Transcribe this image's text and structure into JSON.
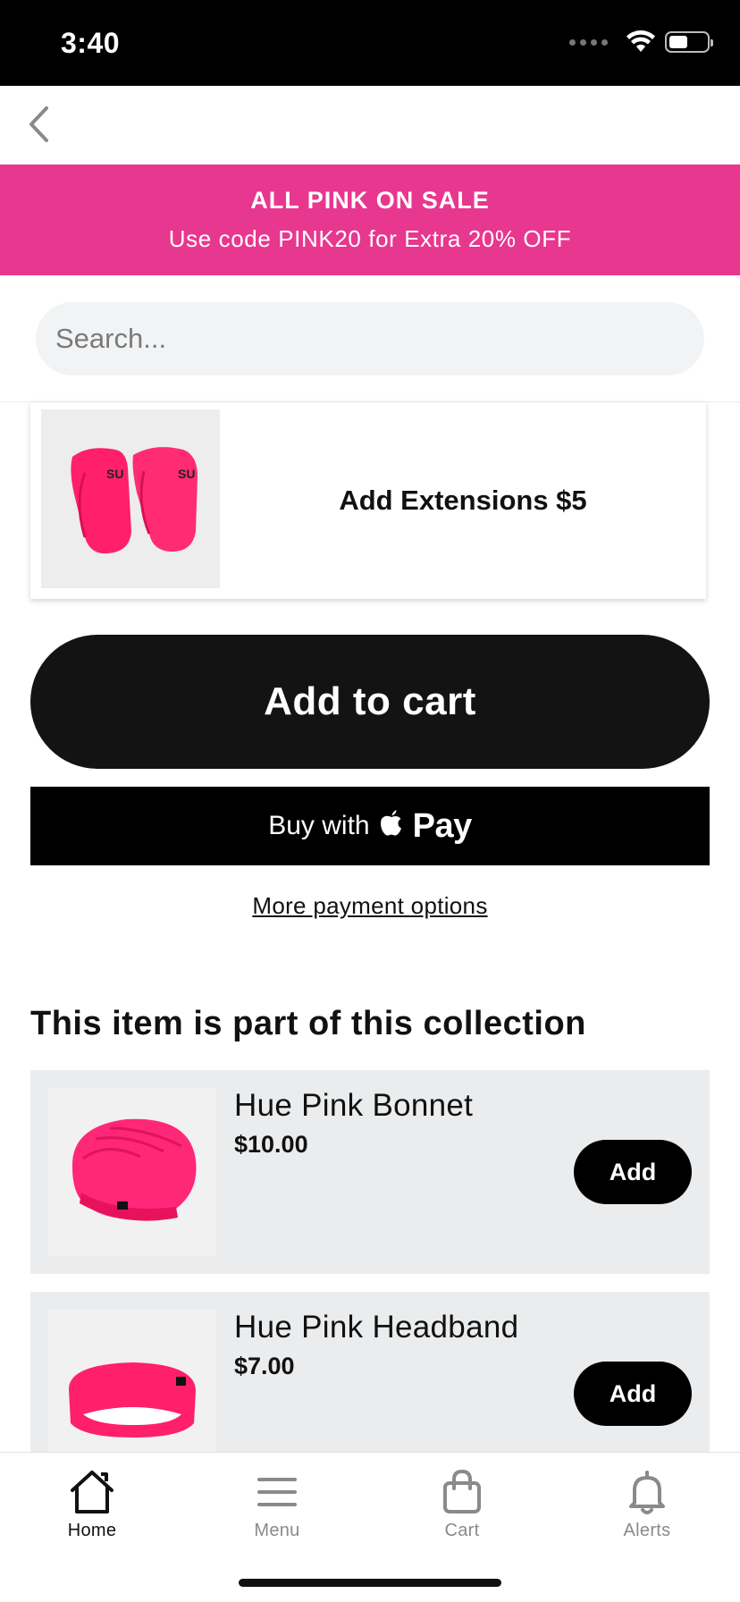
{
  "status_bar": {
    "time": "3:40"
  },
  "promo": {
    "title": "ALL PINK ON SALE",
    "subtitle": "Use code PINK20 for Extra 20% OFF",
    "background": "#e8378f"
  },
  "search": {
    "placeholder": "Search..."
  },
  "extension_option": {
    "label": "Add Extensions $5",
    "image_icon": "pink-sleeves-image"
  },
  "actions": {
    "add_to_cart": "Add to cart",
    "buy_with": "Buy with",
    "pay_word": "Pay",
    "more_payment_options": "More payment options"
  },
  "collection": {
    "heading": "This item is part of this collection",
    "items": [
      {
        "name": "Hue Pink Bonnet",
        "price": "$10.00",
        "button": "Add",
        "image_icon": "pink-bonnet-image"
      },
      {
        "name": "Hue Pink Headband",
        "price": "$7.00",
        "button": "Add",
        "image_icon": "pink-headband-image"
      }
    ]
  },
  "tabs": [
    {
      "label": "Home",
      "icon": "home-icon",
      "active": true
    },
    {
      "label": "Menu",
      "icon": "menu-icon",
      "active": false
    },
    {
      "label": "Cart",
      "icon": "cart-bag-icon",
      "active": false
    },
    {
      "label": "Alerts",
      "icon": "bell-icon",
      "active": false
    }
  ],
  "colors": {
    "accent_pink": "#e8378f",
    "product_pink": "#ff1f6a",
    "button_black": "#131313"
  }
}
